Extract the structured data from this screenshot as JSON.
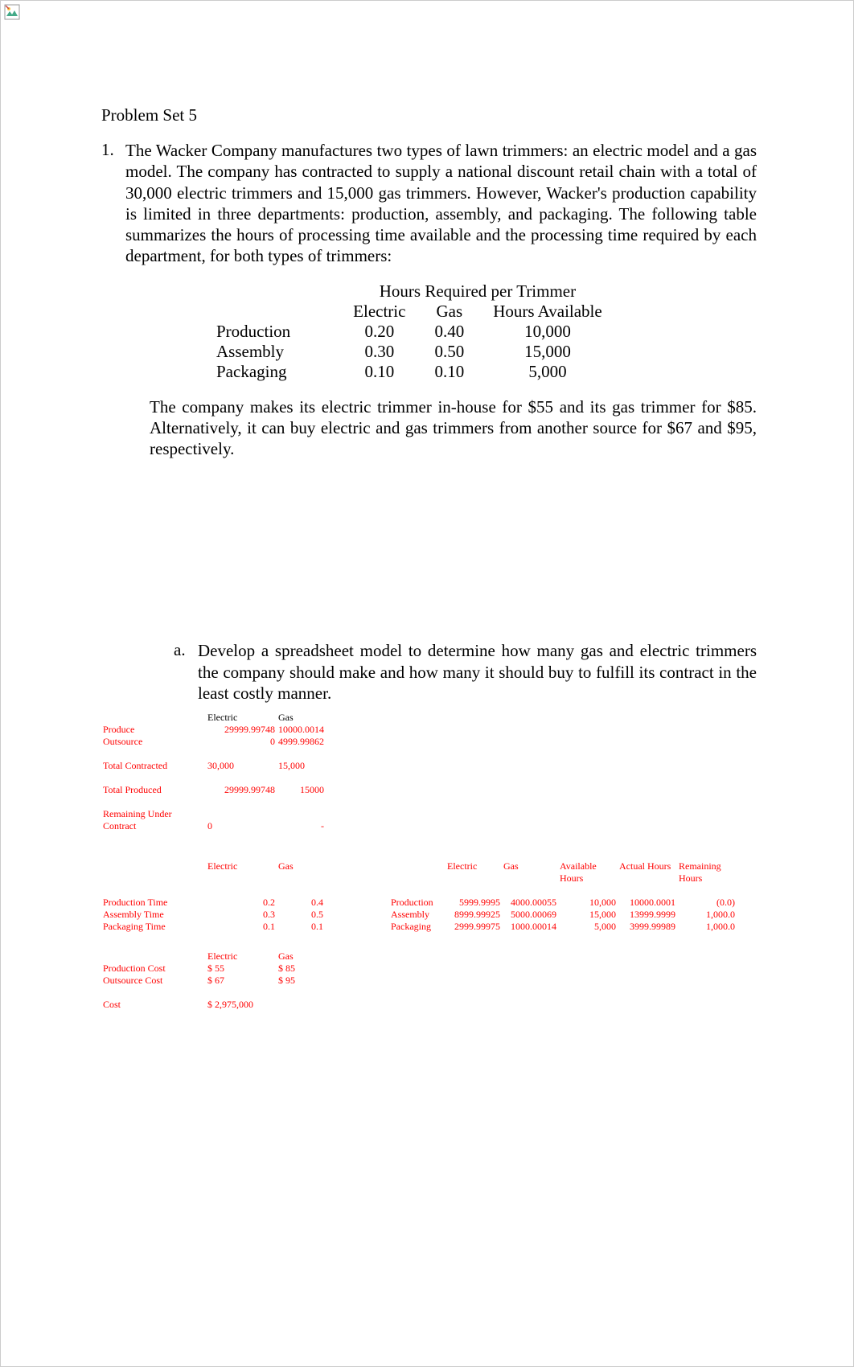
{
  "broken_img_alt": "broken-image",
  "title": "Problem Set 5",
  "problem": {
    "number": "1.",
    "text": "The Wacker Company manufactures two types of lawn trimmers: an electric model and a gas model. The company has contracted to supply a national discount retail chain with a total of 30,000 electric trimmers and 15,000 gas trimmers. However, Wacker's production capability is limited in three departments: production, assembly, and packaging. The following table summarizes the hours of processing time available and the processing time required by each department, for both types of trimmers:"
  },
  "hours_table": {
    "header_span": "Hours Required per Trimmer",
    "col_electric": "Electric",
    "col_gas": "Gas",
    "col_hours": "Hours Available",
    "rows": [
      {
        "label": "Production",
        "electric": "0.20",
        "gas": "0.40",
        "hours": "10,000"
      },
      {
        "label": "Assembly",
        "electric": "0.30",
        "gas": "0.50",
        "hours": "15,000"
      },
      {
        "label": "Packaging",
        "electric": "0.10",
        "gas": "0.10",
        "hours": "5,000"
      }
    ]
  },
  "followup_text": "The company makes its electric trimmer in-house for $55 and its gas trimmer for $85. Alternatively, it can buy electric and gas trimmers from another source for $67 and $95, respectively.",
  "sub_problem": {
    "letter": "a.",
    "text": "Develop a spreadsheet model to determine how many gas and electric trimmers the company should make and how many it should buy to fulfill its contract in the least costly manner."
  },
  "spreadsheet1": {
    "col1": "Electric",
    "col2": "Gas",
    "rows": [
      {
        "label": "Produce",
        "v1": "29999.99748",
        "v2": "10000.0014"
      },
      {
        "label": "Outsource",
        "v1": "0",
        "v2": "4999.99862"
      },
      {
        "label": "",
        "v1": "",
        "v2": ""
      },
      {
        "label": "Total Contracted",
        "v1": "30,000",
        "v2": "15,000"
      },
      {
        "label": "",
        "v1": "",
        "v2": ""
      },
      {
        "label": "Total Produced",
        "v1": "29999.99748",
        "v2": "15000"
      },
      {
        "label": "",
        "v1": "",
        "v2": ""
      },
      {
        "label": "Remaining Under Contract",
        "v1": "0",
        "v2": "-"
      }
    ]
  },
  "spreadsheet2": {
    "headers": [
      "",
      "Electric",
      "Gas",
      "",
      "",
      "Electric",
      "Gas",
      "Available Hours",
      "Actual Hours",
      "Remaining Hours"
    ],
    "rows": [
      {
        "c0": "Production Time",
        "c1": "0.2",
        "c2": "0.4",
        "c3": "",
        "c4": "Production",
        "c5": "5999.9995",
        "c6": "4000.00055",
        "c7": "10,000",
        "c8": "10000.0001",
        "c9": "(0.0)"
      },
      {
        "c0": "Assembly Time",
        "c1": "0.3",
        "c2": "0.5",
        "c3": "",
        "c4": "Assembly",
        "c5": "8999.99925",
        "c6": "5000.00069",
        "c7": "15,000",
        "c8": "13999.9999",
        "c9": "1,000.0"
      },
      {
        "c0": "Packaging Time",
        "c1": "0.1",
        "c2": "0.1",
        "c3": "",
        "c4": "Packaging",
        "c5": "2999.99975",
        "c6": "1000.00014",
        "c7": "5,000",
        "c8": "3999.99989",
        "c9": "1,000.0"
      }
    ]
  },
  "spreadsheet3": {
    "col1": "Electric",
    "col2": "Gas",
    "rows": [
      {
        "label": "Production Cost",
        "v1": "$ 55",
        "v2": "$ 85"
      },
      {
        "label": "Outsource Cost",
        "v1": "$ 67",
        "v2": "$ 95"
      }
    ],
    "cost_label": "Cost",
    "cost_value": "$ 2,975,000"
  }
}
